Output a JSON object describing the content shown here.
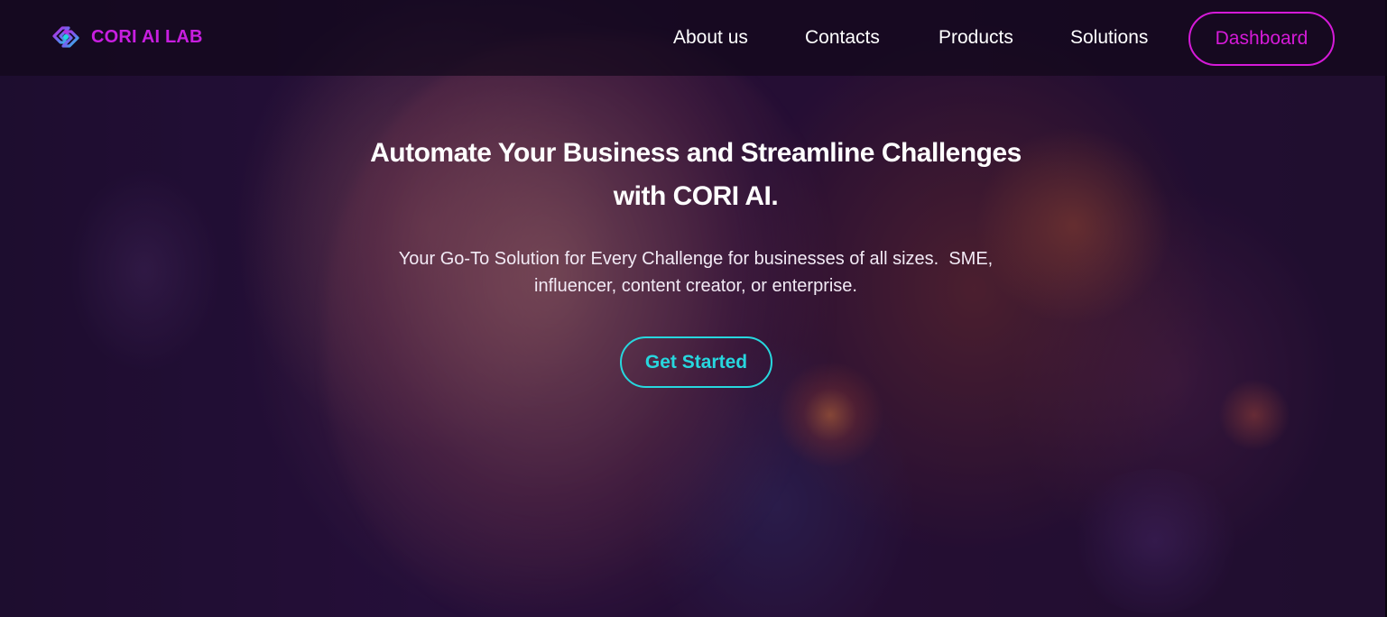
{
  "brand": {
    "name": "CORI AI LAB",
    "logo_icon": "cori-link-logo-icon",
    "color": "#c81ee0"
  },
  "nav": {
    "links": [
      {
        "label": "About us"
      },
      {
        "label": "Contacts"
      },
      {
        "label": "Products"
      },
      {
        "label": "Solutions"
      }
    ],
    "dashboard_label": "Dashboard",
    "dashboard_color": "#d51ad8"
  },
  "hero": {
    "headline_line1": "Automate Your Business and Streamline Challenges",
    "headline_line2": "with CORI AI.",
    "subtext_line1": "Your Go-To Solution for Every Challenge for businesses of all sizes.  SME,",
    "subtext_line2": "influencer, content creator, or enterprise.",
    "cta_label": "Get Started",
    "cta_color": "#27d7de",
    "background_image": "ai-face-artwork"
  }
}
